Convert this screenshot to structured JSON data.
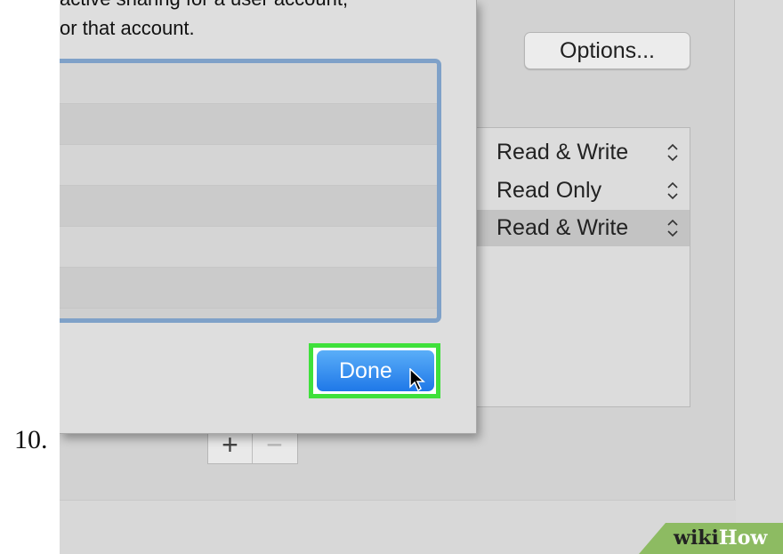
{
  "step": {
    "number": "10."
  },
  "sheet": {
    "instruction_line1": "active sharing for a user account,",
    "instruction_line2": "or that account.",
    "done_label": "Done"
  },
  "sidebar": {
    "options_label": "Options...",
    "permissions": [
      {
        "label": "Read & Write",
        "selected": false
      },
      {
        "label": "Read Only",
        "selected": false
      },
      {
        "label": "Read & Write",
        "selected": true
      }
    ],
    "add_label": "+",
    "remove_label": "−"
  },
  "watermark": {
    "part1": "wiki",
    "part2": "How"
  },
  "colors": {
    "highlight": "#3fe03b",
    "done_button": "#1f78e8",
    "list_focus_ring": "#7fa1c8",
    "watermark_bg": "#8dbb62"
  },
  "icons": {
    "stepper": "chevron-updown-icon",
    "cursor": "mouse-pointer-icon"
  }
}
